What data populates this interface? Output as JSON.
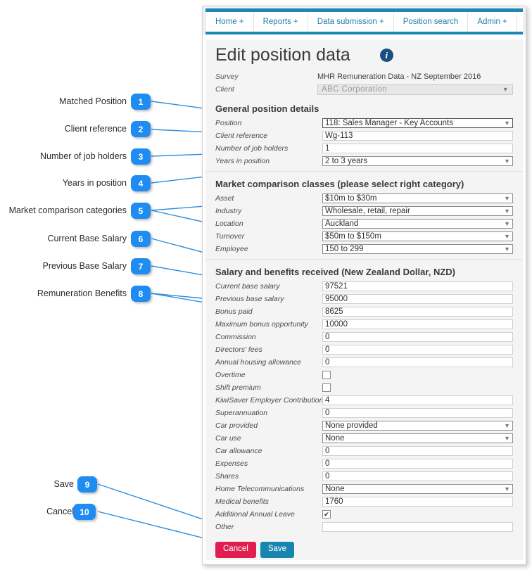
{
  "annotations": {
    "items": [
      {
        "num": "1",
        "label": "Matched Position"
      },
      {
        "num": "2",
        "label": "Client reference"
      },
      {
        "num": "3",
        "label": "Number of job holders"
      },
      {
        "num": "4",
        "label": "Years in position"
      },
      {
        "num": "5",
        "label": "Market comparison categories"
      },
      {
        "num": "6",
        "label": "Current Base Salary"
      },
      {
        "num": "7",
        "label": "Previous Base Salary"
      },
      {
        "num": "8",
        "label": "Remuneration Benefits"
      },
      {
        "num": "9",
        "label": "Save"
      },
      {
        "num": "10",
        "label": "Cancel"
      }
    ],
    "badge_color": "#1f8cf2",
    "line_color": "#2e8de0"
  },
  "nav": {
    "items": [
      {
        "label": "Home +"
      },
      {
        "label": "Reports +"
      },
      {
        "label": "Data submission +"
      },
      {
        "label": "Position search"
      },
      {
        "label": "Admin +"
      }
    ],
    "accent_color": "#1b87b4"
  },
  "header": {
    "title": "Edit position data",
    "info_icon": "info-icon"
  },
  "meta": {
    "survey_label": "Survey",
    "survey_value": "MHR Remuneration Data - NZ September 2016",
    "client_label": "Client",
    "client_value": "ABC Corporation"
  },
  "sections": {
    "general": {
      "title": "General position details",
      "fields": [
        {
          "label": "Position",
          "type": "select",
          "value": "118: Sales Manager - Key Accounts",
          "strong": true
        },
        {
          "label": "Client reference",
          "type": "text",
          "value": "Wg-113"
        },
        {
          "label": "Number of job holders",
          "type": "text",
          "value": "1"
        },
        {
          "label": "Years in position",
          "type": "select",
          "value": "2 to 3 years"
        }
      ]
    },
    "market": {
      "title": "Market comparison classes (please select right category)",
      "fields": [
        {
          "label": "Asset",
          "type": "select",
          "value": "$10m to $30m"
        },
        {
          "label": "Industry",
          "type": "select",
          "value": "Wholesale, retail, repair"
        },
        {
          "label": "Location",
          "type": "select",
          "value": "Auckland"
        },
        {
          "label": "Turnover",
          "type": "select",
          "value": "$50m to $150m"
        },
        {
          "label": "Employee",
          "type": "select",
          "value": "150 to 299"
        }
      ]
    },
    "salary": {
      "title": "Salary and benefits received (New Zealand Dollar, NZD)",
      "fields": [
        {
          "label": "Current base salary",
          "type": "text",
          "value": "97521"
        },
        {
          "label": "Previous base salary",
          "type": "text",
          "value": "95000"
        },
        {
          "label": "Bonus paid",
          "type": "text",
          "value": "8625"
        },
        {
          "label": "Maximum bonus opportunity",
          "type": "text",
          "value": "10000"
        },
        {
          "label": "Commission",
          "type": "text",
          "value": "0"
        },
        {
          "label": "Directors' fees",
          "type": "text",
          "value": "0"
        },
        {
          "label": "Annual housing allowance",
          "type": "text",
          "value": "0"
        },
        {
          "label": "Overtime",
          "type": "checkbox",
          "value": false
        },
        {
          "label": "Shift premium",
          "type": "checkbox",
          "value": false
        },
        {
          "label": "KiwiSaver Employer Contribution (%)",
          "type": "text",
          "value": "4"
        },
        {
          "label": "Superannuation",
          "type": "text",
          "value": "0"
        },
        {
          "label": "Car provided",
          "type": "select",
          "value": "None provided"
        },
        {
          "label": "Car use",
          "type": "select",
          "value": "None"
        },
        {
          "label": "Car allowance",
          "type": "text",
          "value": "0"
        },
        {
          "label": "Expenses",
          "type": "text",
          "value": "0"
        },
        {
          "label": "Shares",
          "type": "text",
          "value": "0"
        },
        {
          "label": "Home Telecommunications",
          "type": "select",
          "value": "None"
        },
        {
          "label": "Medical benefits",
          "type": "text",
          "value": "1760"
        },
        {
          "label": "Additional Annual Leave",
          "type": "checkbox",
          "value": true
        },
        {
          "label": "Other",
          "type": "text",
          "value": ""
        }
      ]
    }
  },
  "buttons": {
    "cancel_label": "Cancel",
    "save_label": "Save",
    "cancel_color": "#e01f50",
    "save_color": "#1885b0"
  }
}
